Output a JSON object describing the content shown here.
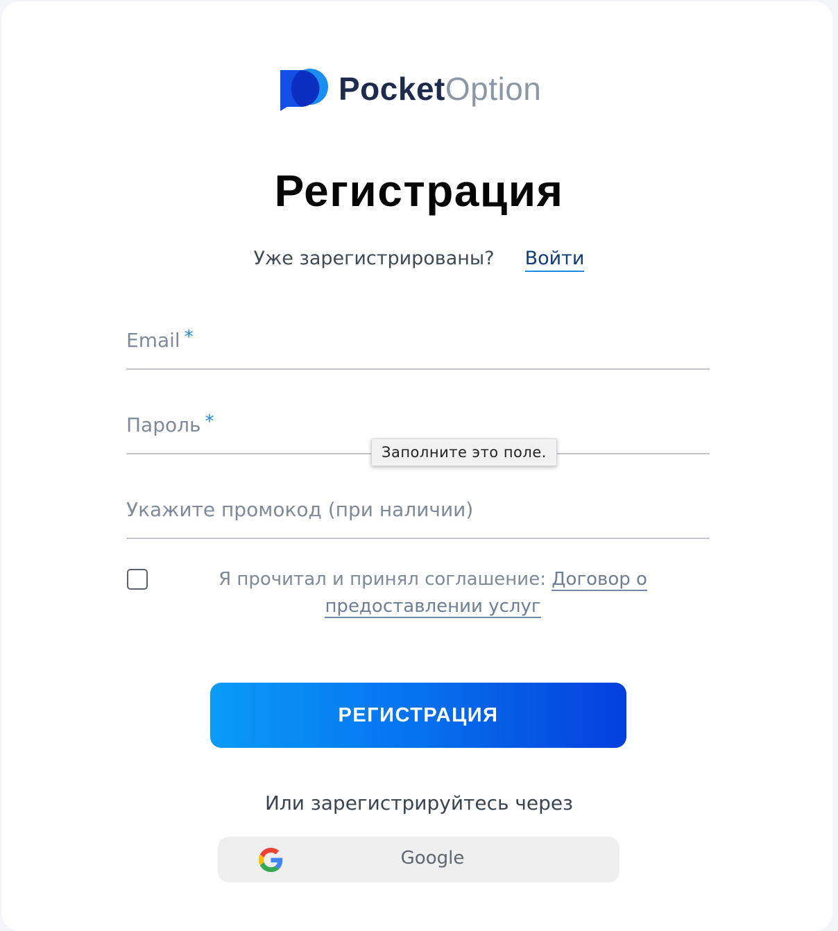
{
  "brand": {
    "name_part1": "Pocket",
    "name_part2": "Option"
  },
  "page": {
    "title": "Регистрация"
  },
  "login_prompt": {
    "question": "Уже зарегистрированы?",
    "login_link": "Войти"
  },
  "form": {
    "email": {
      "label": "Email",
      "required_mark": "*",
      "value": ""
    },
    "password": {
      "label": "Пароль",
      "required_mark": "*",
      "value": ""
    },
    "promo": {
      "label": "Укажите промокод (при наличии)",
      "value": ""
    },
    "validation_tooltip": "Заполните это поле.",
    "agreement": {
      "checked": false,
      "text": "Я прочитал и принял соглашение: ",
      "link_part1": "Договор о",
      "link_part2": "предоставлении услуг"
    },
    "submit_label": "РЕГИСТРАЦИЯ"
  },
  "social": {
    "prompt": "Или зарегистрируйтесь через",
    "google_label": "Google"
  },
  "colors": {
    "accent_blue": "#1e88e5",
    "button_gradient_start": "#0a9bf7",
    "button_gradient_end": "#0440dc"
  }
}
